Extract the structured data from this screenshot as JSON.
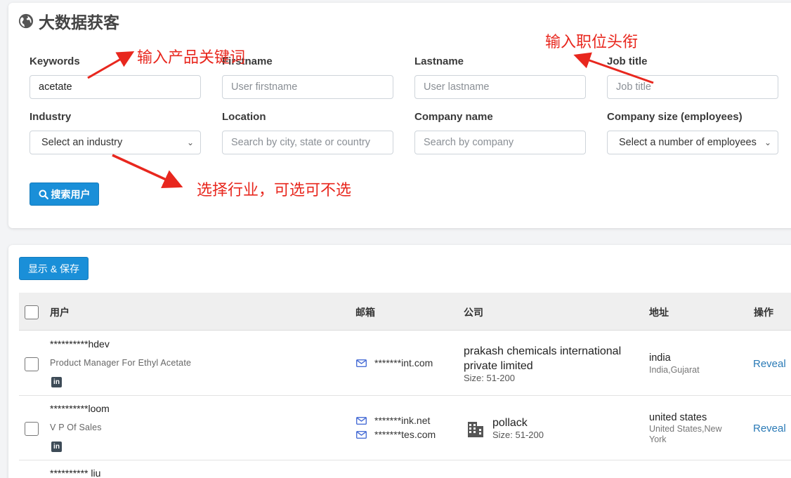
{
  "header": {
    "title": "大数据获客"
  },
  "form": {
    "keywords": {
      "label": "Keywords",
      "value": "acetate"
    },
    "firstname": {
      "label": "Firstname",
      "placeholder": "User firstname"
    },
    "lastname": {
      "label": "Lastname",
      "placeholder": "User lastname"
    },
    "job_title": {
      "label": "Job title",
      "placeholder": "Job title"
    },
    "industry": {
      "label": "Industry",
      "selected": "Select an industry"
    },
    "location": {
      "label": "Location",
      "placeholder": "Search by city, state or country"
    },
    "company_name": {
      "label": "Company name",
      "placeholder": "Search by company"
    },
    "company_size": {
      "label": "Company size (employees)",
      "selected": "Select a number of employees"
    },
    "search_button": "搜索用户"
  },
  "annotations": {
    "keywords_hint": "输入产品关键词",
    "job_title_hint": "输入职位头衔",
    "industry_hint": "选择行业，可选可不选",
    "color": "#e8271e"
  },
  "results": {
    "show_save_button": "显示 & 保存",
    "columns": [
      "用户",
      "邮箱",
      "公司",
      "地址",
      "操作"
    ],
    "rows": [
      {
        "name": "**********hdev",
        "title": "Product Manager For Ethyl Acetate",
        "emails": [
          "*******int.com"
        ],
        "company": "prakash chemicals international private limited",
        "company_size": "Size: 51-200",
        "country": "india",
        "region": "India,Gujarat",
        "action": "Reveal"
      },
      {
        "name": "**********loom",
        "title": "V P Of Sales",
        "emails": [
          "*******ink.net",
          "*******tes.com"
        ],
        "company": "pollack",
        "company_size": "Size: 51-200",
        "country": "united states",
        "region": "United States,New York",
        "action": "Reveal"
      },
      {
        "name": "********** liu"
      }
    ]
  },
  "colors": {
    "primary": "#1a8fd8",
    "link": "#2a7ab6"
  }
}
